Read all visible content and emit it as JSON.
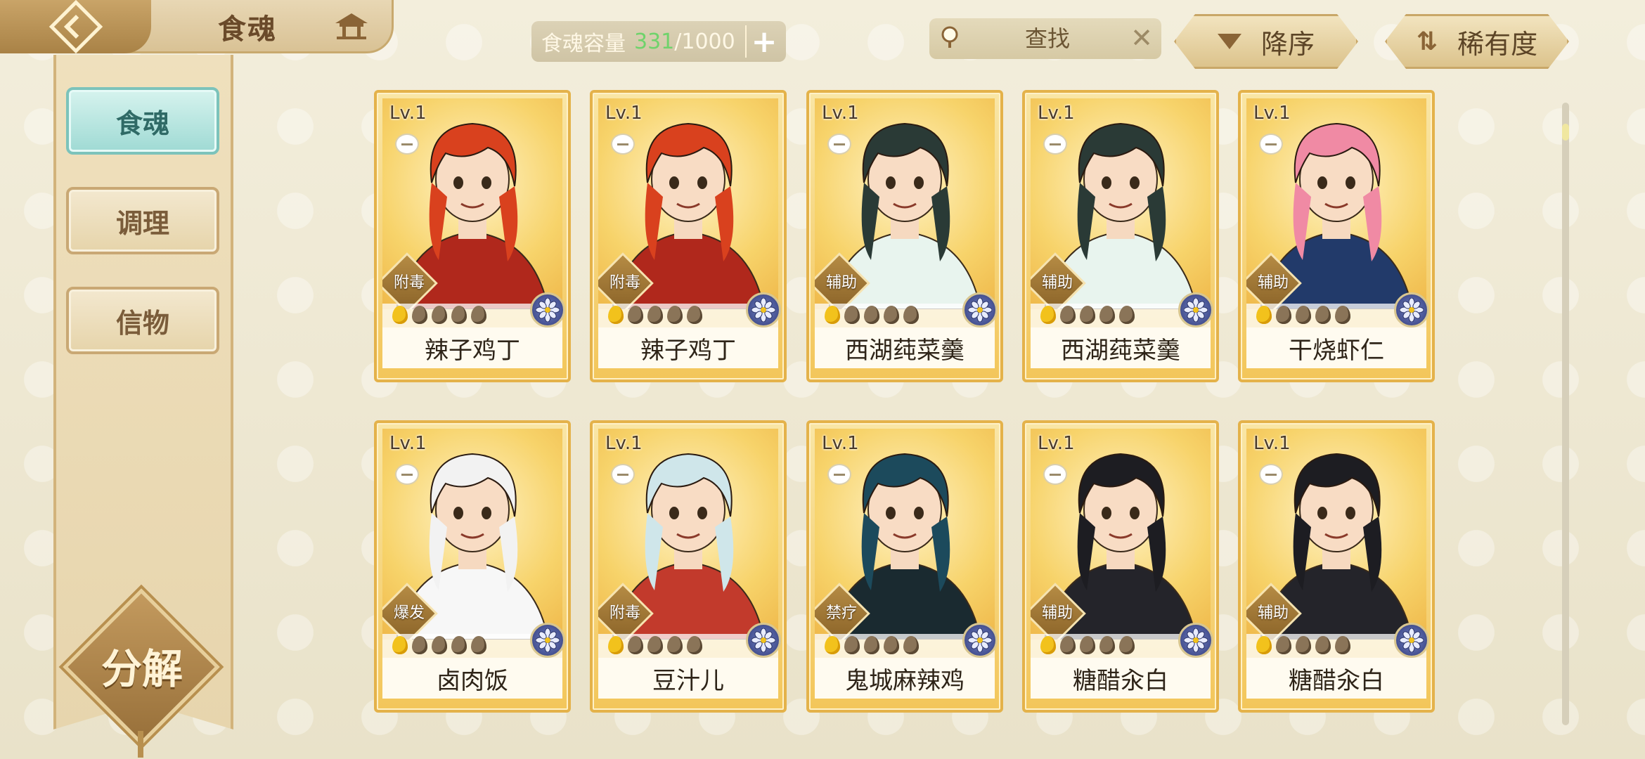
{
  "header": {
    "title": "食魂",
    "capacity_label": "食魂容量",
    "capacity_used": "331",
    "capacity_total": "/1000",
    "add_label": "+",
    "search_placeholder": "查找",
    "clear_label": "✕",
    "sort_desc_label": "降序",
    "sort_rarity_label": "稀有度"
  },
  "sidebar": {
    "items": [
      {
        "label": "食魂",
        "active": true
      },
      {
        "label": "调理",
        "active": false
      },
      {
        "label": "信物",
        "active": false
      }
    ],
    "decompose_label": "分解"
  },
  "colors": {
    "accent_teal": "#9fdad4",
    "card_gold": "#f3c65a",
    "capacity_green": "#6fd36b"
  },
  "cards": [
    {
      "level": "Lv.1",
      "name": "辣子鸡丁",
      "role": "附毒",
      "stars_on": 1,
      "stars_total": 5,
      "hair": "#d9411e",
      "outfit": "#b0281c"
    },
    {
      "level": "Lv.1",
      "name": "辣子鸡丁",
      "role": "附毒",
      "stars_on": 1,
      "stars_total": 5,
      "hair": "#d9411e",
      "outfit": "#b0281c"
    },
    {
      "level": "Lv.1",
      "name": "西湖莼菜羹",
      "role": "辅助",
      "stars_on": 1,
      "stars_total": 5,
      "hair": "#2a3a36",
      "outfit": "#e8f4ee"
    },
    {
      "level": "Lv.1",
      "name": "西湖莼菜羹",
      "role": "辅助",
      "stars_on": 1,
      "stars_total": 5,
      "hair": "#2a3a36",
      "outfit": "#e8f4ee"
    },
    {
      "level": "Lv.1",
      "name": "干烧虾仁",
      "role": "辅助",
      "stars_on": 1,
      "stars_total": 5,
      "hair": "#f08aa4",
      "outfit": "#223a6a"
    },
    {
      "level": "Lv.1",
      "name": "卤肉饭",
      "role": "爆发",
      "stars_on": 1,
      "stars_total": 5,
      "hair": "#f2f2f2",
      "outfit": "#f7f7f7"
    },
    {
      "level": "Lv.1",
      "name": "豆汁儿",
      "role": "附毒",
      "stars_on": 1,
      "stars_total": 5,
      "hair": "#cfe6ea",
      "outfit": "#c23a2c"
    },
    {
      "level": "Lv.1",
      "name": "鬼城麻辣鸡",
      "role": "禁疗",
      "stars_on": 1,
      "stars_total": 5,
      "hair": "#1c4a5c",
      "outfit": "#1a2a30"
    },
    {
      "level": "Lv.1",
      "name": "糖醋汆白",
      "role": "辅助",
      "stars_on": 1,
      "stars_total": 5,
      "hair": "#1d1d22",
      "outfit": "#24242a"
    },
    {
      "level": "Lv.1",
      "name": "糖醋汆白",
      "role": "辅助",
      "stars_on": 1,
      "stars_total": 5,
      "hair": "#1d1d22",
      "outfit": "#24242a"
    }
  ]
}
